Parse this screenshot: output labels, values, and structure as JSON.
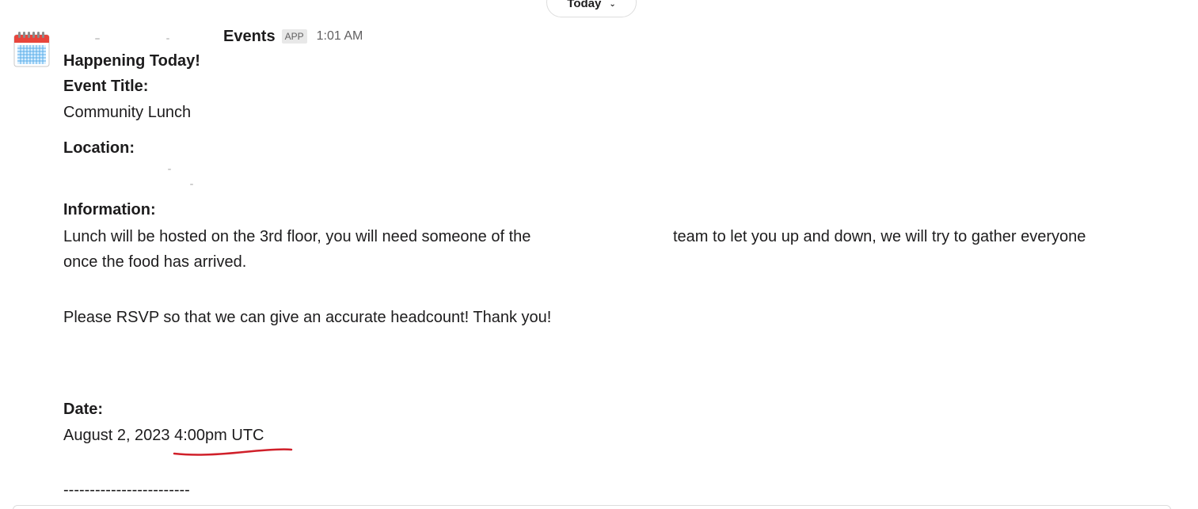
{
  "divider": {
    "label": "Today",
    "chevron_icon": "chevron-down-icon"
  },
  "message": {
    "avatar_icon": "calendar-icon",
    "sender": "Events",
    "badge": "APP",
    "time": "1:01 AM",
    "heading": "Happening Today!",
    "event_title_label": "Event Title:",
    "event_title": "Community Lunch",
    "location_label": "Location:",
    "information_label": "Information:",
    "information_line1_a": "Lunch will be hosted on the 3rd floor, you will need someone of the",
    "information_line1_b": "team to let you up and down, we will try to gather everyone",
    "information_line2": "once the food has arrived.",
    "rsvp": "Please RSVP so that we can give an accurate headcount! Thank you!",
    "date_label": "Date:",
    "date_value": "August 2, 2023 4:00pm UTC",
    "separator": "------------------------"
  },
  "colors": {
    "text": "#1d1c1d",
    "muted": "#616061",
    "badge_bg": "#e8e8e8",
    "annotation_underline": "#d0202a"
  }
}
